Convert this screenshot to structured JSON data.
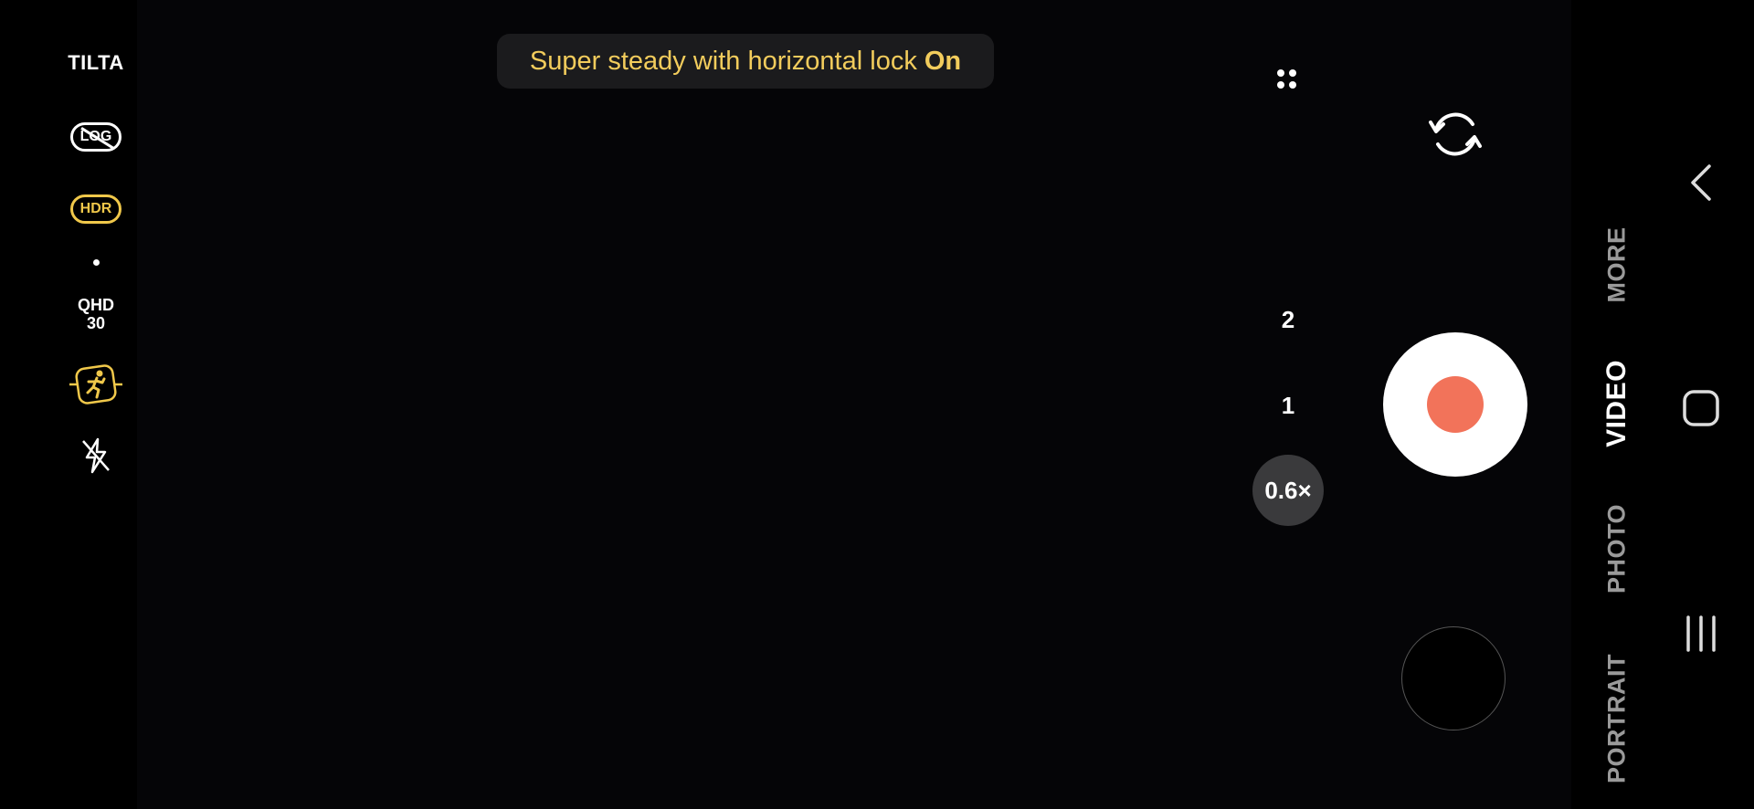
{
  "left_panel": {
    "brand": "TILTA",
    "log_label": "LOG",
    "hdr_label": "HDR",
    "resolution": "QHD",
    "fps": "30",
    "motion_icon": "running-person-icon",
    "flash_icon": "flash-off-icon"
  },
  "toast": {
    "text": "Super steady with horizontal lock",
    "state": "On"
  },
  "zoom": {
    "options": [
      "2",
      "1",
      "0.6×"
    ],
    "selected": "0.6×"
  },
  "modes": {
    "items": [
      "PORTRAIT",
      "PHOTO",
      "VIDEO",
      "MORE"
    ],
    "active": "VIDEO"
  },
  "colors": {
    "accent_yellow": "#f2cc5c",
    "record_red": "#f2735a",
    "zoom_bg": "#3a3a3c"
  },
  "nav": {
    "back_icon": "back-chevron-icon",
    "home_icon": "home-icon",
    "recents_icon": "recents-icon"
  }
}
